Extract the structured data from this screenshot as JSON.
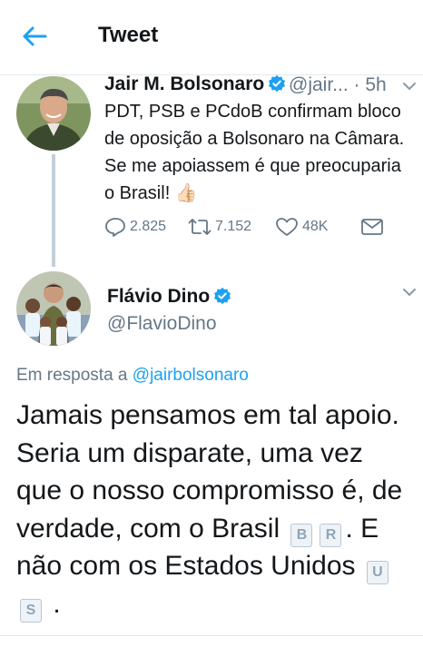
{
  "header": {
    "title": "Tweet"
  },
  "parent_tweet": {
    "name": "Jair M. Bolsonaro",
    "handle_time": "@jair... · 5h",
    "text": "PDT, PSB e PCdoB confirmam bloco de oposição a Bolsonaro na Câmara. Se me apoiassem é que preocuparia o Brasil! 👍🏻",
    "replies": "2.825",
    "retweets": "7.152",
    "likes": "48K"
  },
  "reply_tweet": {
    "name": "Flávio Dino",
    "handle": "@FlavioDino",
    "reply_prefix": "Em resposta a ",
    "reply_handle": "@jairbolsonaro",
    "text_part1": "Jamais pensamos em tal apoio. Seria um disparate, uma vez que o nosso compromisso é, de verdade, com o Brasil",
    "flag1": [
      "B",
      "R"
    ],
    "text_part2": ". E não com os Estados Unidos",
    "flag2": [
      "U",
      "S"
    ],
    "text_part3": "."
  },
  "colors": {
    "accent": "#1da1f2",
    "muted": "#657786",
    "text": "#14171a"
  }
}
